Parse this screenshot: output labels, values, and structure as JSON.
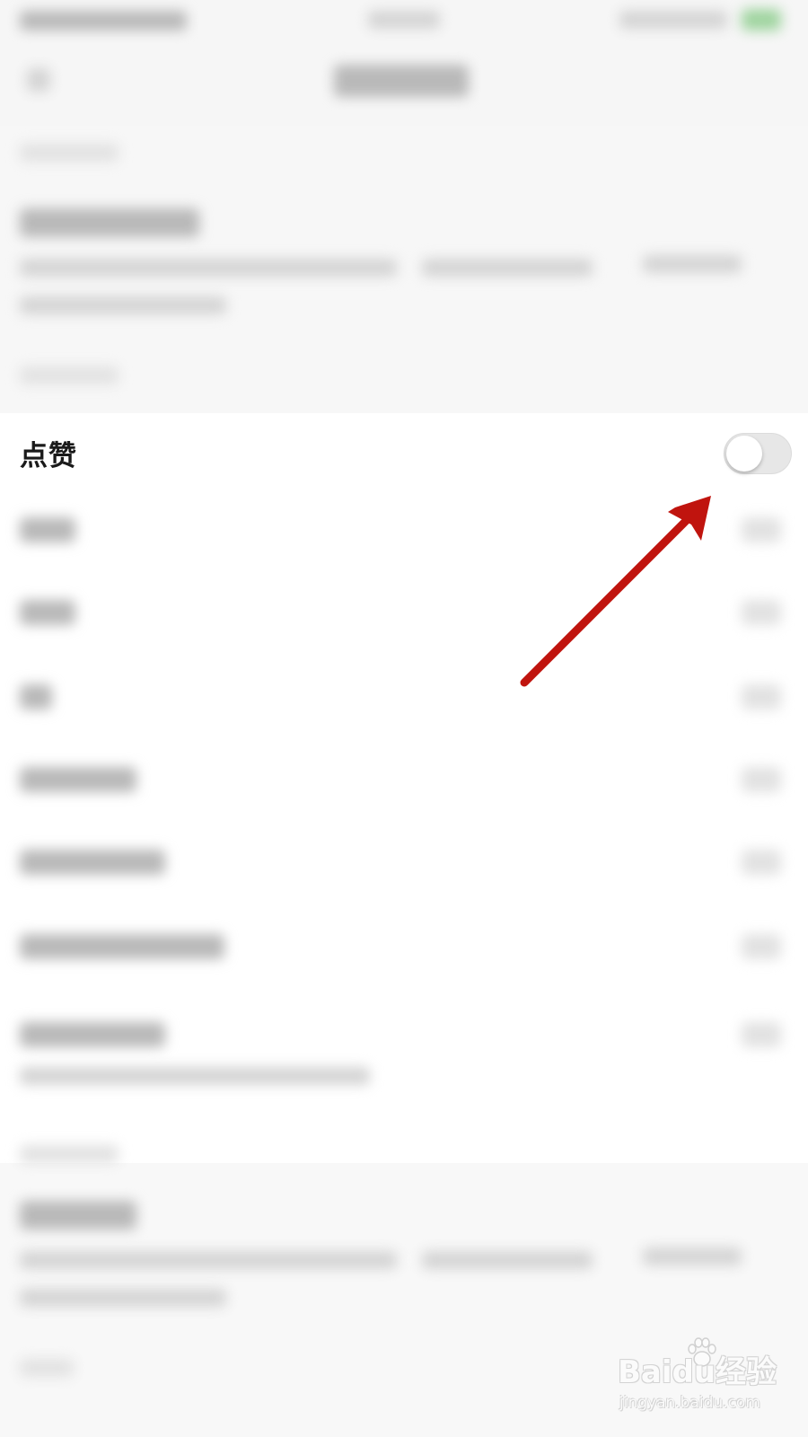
{
  "like_setting": {
    "label": "点赞",
    "enabled": false
  },
  "annotation": {
    "arrow_color": "#c0140e",
    "target": "like-toggle"
  },
  "watermark": {
    "brand": "Baidu经验",
    "url": "jingyan.baidu.com"
  },
  "colors": {
    "toggle_off_track": "#e7e7e7",
    "page_background": "#f6f6f6"
  }
}
